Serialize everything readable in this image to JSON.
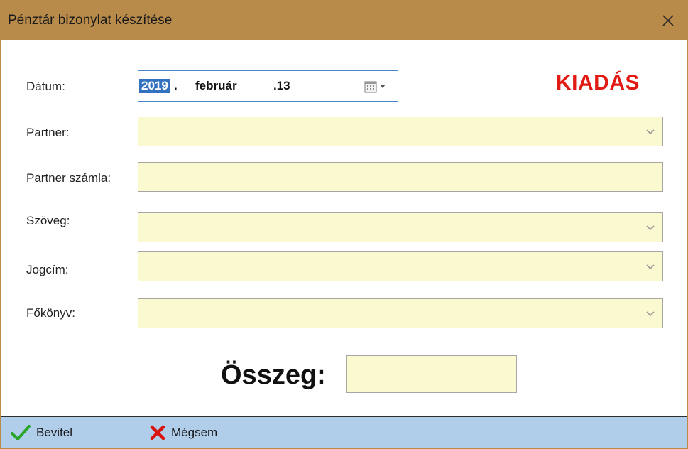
{
  "window": {
    "title": "Pénztár bizonylat készítése",
    "close_glyph": "✕"
  },
  "form": {
    "date_label": "Dátum:",
    "date": {
      "year": "2019",
      "year_sep": ".",
      "month": "február",
      "day": ".13"
    },
    "mode": "KIADÁS",
    "mode_color": "#e11a14",
    "partner_label": "Partner:",
    "partner_value": "",
    "partner_account_label": "Partner számla:",
    "partner_account_value": "",
    "text_label": "Szöveg:",
    "text_value": "",
    "title_label": "Jogcím:",
    "title_value": "",
    "ledger_label": "Főkönyv:",
    "ledger_value": "",
    "amount_label": "Összeg:",
    "amount_value": ""
  },
  "toolbar": {
    "ok_label": "Bevitel",
    "ok_icon": "checkmark-icon",
    "cancel_label": "Mégsem",
    "cancel_icon": "x-icon"
  },
  "colors": {
    "titlebar": "#b98b4b",
    "field_bg": "#fbf9d0",
    "toolbar_bg": "#b0cde9",
    "accent_blue": "#3472c0"
  }
}
